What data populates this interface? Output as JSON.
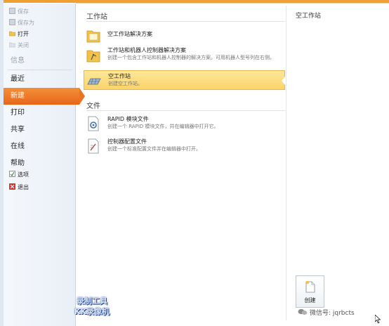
{
  "sidebar": {
    "small_top": [
      {
        "label": "保存",
        "icon": "save-icon"
      },
      {
        "label": "保存为",
        "icon": "save-as-icon"
      },
      {
        "label": "打开",
        "icon": "folder-open-icon"
      },
      {
        "label": "关闭",
        "icon": "close-icon"
      }
    ],
    "info": "信息",
    "recent": "最近",
    "new": "新建",
    "print": "打印",
    "share": "共享",
    "online": "在线",
    "help": "帮助",
    "options": "选项",
    "exit": "退出"
  },
  "main": {
    "section_station": "工作站",
    "item_solution": {
      "title": "空工作站解决方案",
      "desc": ""
    },
    "item_solution_ctrl": {
      "title": "工作站和机器人控制器解决方案",
      "desc": "创建一个包含工作站和机器人控制器的解决方案。可用机器人型号列在右侧。"
    },
    "item_empty": {
      "title": "空工作站",
      "desc": "创建空工作站。"
    },
    "section_file": "文件",
    "item_rapid": {
      "title": "RAPID 模块文件",
      "desc": "创建一个 RAPID 模块文件，并在编辑器中打开它。"
    },
    "item_config": {
      "title": "控制器配置文件",
      "desc": "创建一个标准配置文件并在编辑器中打开。"
    }
  },
  "preview": {
    "title": "空工作站",
    "create_label": "创建"
  },
  "overlay": {
    "watermark_line1": "录制工具",
    "watermark_line2": "KK录像机",
    "wechat": "微信号: jqrbcts"
  },
  "colors": {
    "accent": "#e97522",
    "selected": "#fbd46a"
  }
}
